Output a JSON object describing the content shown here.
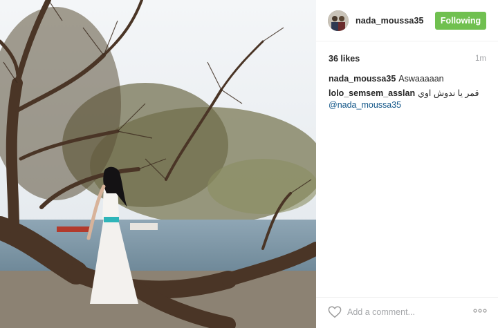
{
  "post": {
    "image_description_icon": "photo"
  },
  "header": {
    "username": "nada_moussa35",
    "follow_label": "Following"
  },
  "stats": {
    "likes": "36 likes",
    "time": "1m"
  },
  "comments": [
    {
      "user": "nada_moussa35",
      "text": "Aswaaaaan",
      "mention": ""
    },
    {
      "user": "lolo_semsem_asslan",
      "text": "قمر يا ندوش اوي",
      "mention": "@nada_moussa35"
    }
  ],
  "footer": {
    "comment_placeholder": "Add a comment...",
    "like_icon": "heart-icon",
    "more_icon": "more-options-icon"
  },
  "colors": {
    "follow_button": "#70c050",
    "mention": "#125688",
    "muted": "#a5a7aa"
  }
}
